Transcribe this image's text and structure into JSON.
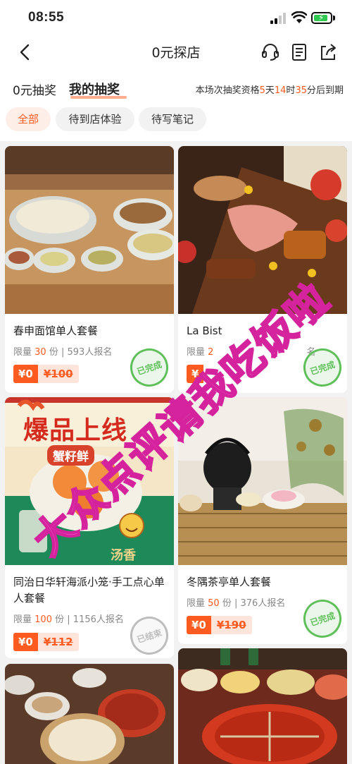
{
  "status_bar": {
    "time": "08:55"
  },
  "nav": {
    "title": "0元探店"
  },
  "tabs": [
    {
      "label": "0元抽奖"
    },
    {
      "label": "我的抽奖"
    }
  ],
  "deadline": {
    "prefix": "本场次抽奖资格",
    "days": "5",
    "day_unit": "天",
    "hours": "14",
    "hour_unit": "时",
    "minutes": "35",
    "suffix": "分后到期"
  },
  "filters": [
    {
      "label": "全部",
      "active": true
    },
    {
      "label": "待到店体验",
      "active": false
    },
    {
      "label": "待写笔记",
      "active": false
    }
  ],
  "cards": [
    {
      "title": "春申面馆单人套餐",
      "limit_prefix": "限量",
      "limit": "30",
      "limit_unit": "份",
      "signups": "593人报名",
      "price": "¥0",
      "original_price": "¥100",
      "stamp": "已完成"
    },
    {
      "title": "La Bist",
      "limit_prefix": "限量",
      "limit": "2",
      "limit_unit": "",
      "signups": "名",
      "price": "¥",
      "original_price": "",
      "stamp": "已完成"
    },
    {
      "title": "同治日华轩海派小笼·手工点心单人套餐",
      "limit_prefix": "限量",
      "limit": "100",
      "limit_unit": "份",
      "signups": "1156人报名",
      "price": "¥0",
      "original_price": "¥112",
      "stamp": "已结束",
      "poster_headline": "爆品上线",
      "poster_sub": "蟹籽鲜",
      "poster_tail": "汤香"
    },
    {
      "title": "冬隅茶亭单人套餐",
      "limit_prefix": "限量",
      "limit": "50",
      "limit_unit": "份",
      "signups": "376人报名",
      "price": "¥0",
      "original_price": "¥190",
      "stamp": "已完成"
    }
  ],
  "watermark": {
    "text": "大众点评请我吃饭啦"
  },
  "colors": {
    "accent": "#ff5a1f",
    "chip_active_bg": "#fdeee8",
    "stamp_done": "#5fc05a",
    "watermark": "#ff6ee0"
  },
  "icons": [
    "back-icon",
    "customer-service-icon",
    "notes-icon",
    "share-icon"
  ]
}
